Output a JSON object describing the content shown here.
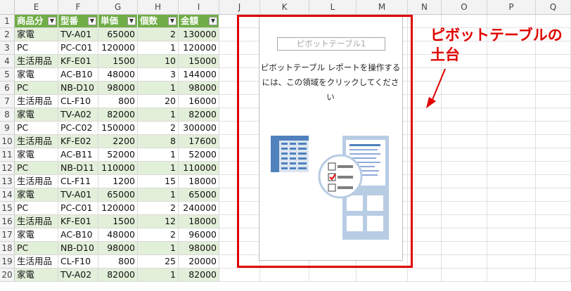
{
  "columns": [
    "E",
    "F",
    "G",
    "H",
    "I",
    "J",
    "K",
    "L",
    "M",
    "N",
    "O",
    "P",
    "Q"
  ],
  "rows": [
    "1",
    "2",
    "3",
    "4",
    "5",
    "6",
    "7",
    "8",
    "9",
    "10",
    "11",
    "12",
    "13",
    "14",
    "15",
    "16",
    "17",
    "18",
    "19",
    "20"
  ],
  "table": {
    "headers": [
      "商品分類",
      "型番",
      "単価",
      "個数",
      "金額"
    ],
    "header_display": [
      "商品分",
      "型番",
      "単価",
      "個数",
      "金額"
    ],
    "filter_glyph": "▼",
    "data": [
      [
        "家電",
        "TV-A01",
        "65000",
        "2",
        "130000"
      ],
      [
        "PC",
        "PC-C01",
        "120000",
        "1",
        "120000"
      ],
      [
        "生活用品",
        "KF-E01",
        "1500",
        "10",
        "15000"
      ],
      [
        "家電",
        "AC-B10",
        "48000",
        "3",
        "144000"
      ],
      [
        "PC",
        "NB-D10",
        "98000",
        "1",
        "98000"
      ],
      [
        "生活用品",
        "CL-F10",
        "800",
        "20",
        "16000"
      ],
      [
        "家電",
        "TV-A02",
        "82000",
        "1",
        "82000"
      ],
      [
        "PC",
        "PC-C02",
        "150000",
        "2",
        "300000"
      ],
      [
        "生活用品",
        "KF-E02",
        "2200",
        "8",
        "17600"
      ],
      [
        "家電",
        "AC-B11",
        "52000",
        "1",
        "52000"
      ],
      [
        "PC",
        "NB-D11",
        "110000",
        "1",
        "110000"
      ],
      [
        "生活用品",
        "CL-F11",
        "1200",
        "15",
        "18000"
      ],
      [
        "家電",
        "TV-A01",
        "65000",
        "1",
        "65000"
      ],
      [
        "PC",
        "PC-C01",
        "120000",
        "2",
        "240000"
      ],
      [
        "生活用品",
        "KF-E01",
        "1500",
        "12",
        "18000"
      ],
      [
        "家電",
        "AC-B10",
        "48000",
        "2",
        "96000"
      ],
      [
        "PC",
        "NB-D10",
        "98000",
        "1",
        "98000"
      ],
      [
        "生活用品",
        "CL-F10",
        "800",
        "25",
        "20000"
      ],
      [
        "家電",
        "TV-A02",
        "82000",
        "1",
        "82000"
      ]
    ]
  },
  "pivot": {
    "title": "ピボットテーブル1",
    "message": "ピボットテーブル レポートを操作するには、この領域をクリックしてください"
  },
  "annotation": {
    "line1": "ピボットテーブルの",
    "line2": "土台",
    "color": "#e10000"
  },
  "colors": {
    "table_header": "#70ad47",
    "table_band": "#e2efd9",
    "pivot_icon_blue": "#4f81bd",
    "pivot_icon_light": "#b8cce4"
  }
}
